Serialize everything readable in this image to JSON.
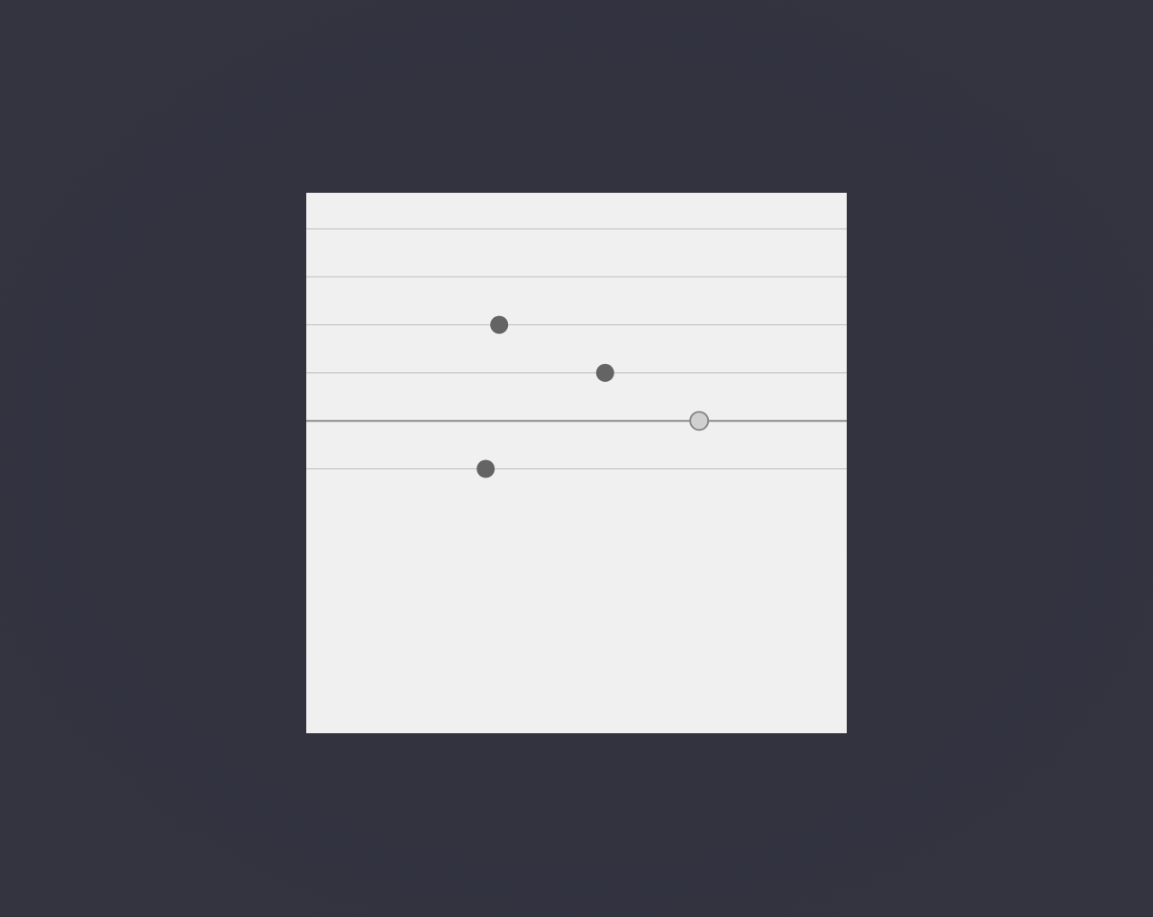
{
  "board": {
    "background": "#f0f0f0",
    "line_color": "#bdbdbd",
    "highlight_line_color": "#8a8a8a",
    "dot_color": "#646464",
    "marker_fill": "#d0d0d0",
    "marker_stroke": "#8a8a8a",
    "line_count": 6,
    "highlighted_line": 5,
    "dots": [
      {
        "line": 3,
        "position": 0.357
      },
      {
        "line": 4,
        "position": 0.553
      },
      {
        "line": 6,
        "position": 0.332
      }
    ],
    "marker": {
      "line": 5,
      "position": 0.727
    }
  }
}
